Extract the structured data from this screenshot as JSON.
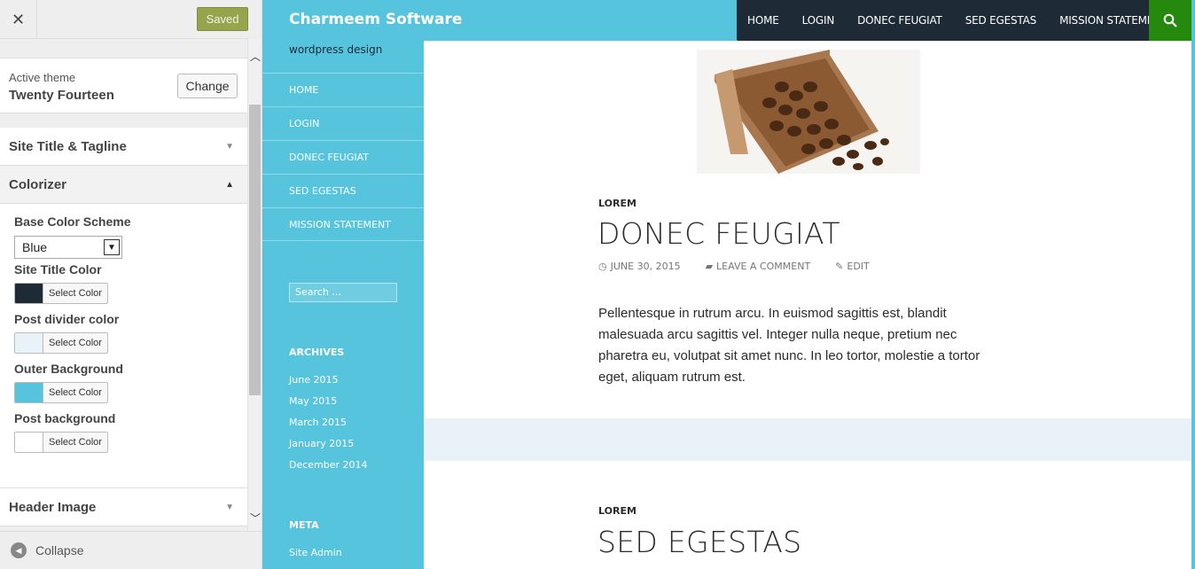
{
  "customizer": {
    "close_icon": "close-icon",
    "saved_label": "Saved",
    "active_theme_label": "Active theme",
    "active_theme_name": "Twenty Fourteen",
    "change_label": "Change",
    "sections": {
      "site_title": "Site Title & Tagline",
      "colorizer": "Colorizer",
      "header_image": "Header Image"
    },
    "colorizer": {
      "base_scheme_label": "Base Color Scheme",
      "base_scheme_value": "Blue",
      "controls": [
        {
          "label": "Site Title Color",
          "button": "Select Color",
          "color": "#1e2b37"
        },
        {
          "label": "Post divider color",
          "button": "Select Color",
          "color": "#e9f1f9"
        },
        {
          "label": "Outer Background",
          "button": "Select Color",
          "color": "#56c4dc"
        },
        {
          "label": "Post background",
          "button": "Select Color",
          "color": "#ffffff"
        }
      ]
    },
    "collapse_label": "Collapse"
  },
  "site": {
    "title": "Charmeem Software",
    "tagline": "wordpress design",
    "top_nav": [
      "HOME",
      "LOGIN",
      "DONEC FEUGIAT",
      "SED EGESTAS",
      "MISSION STATEMENT"
    ],
    "side_nav": [
      "HOME",
      "LOGIN",
      "DONEC FEUGIAT",
      "SED EGESTAS",
      "MISSION STATEMENT"
    ],
    "search_placeholder": "Search …",
    "archives_title": "ARCHIVES",
    "archives": [
      "June 2015",
      "May 2015",
      "March 2015",
      "January 2015",
      "December 2014"
    ],
    "meta_title": "META",
    "meta_links": [
      "Site Admin"
    ]
  },
  "posts": [
    {
      "category": "LOREM",
      "title": "DONEC FEUGIAT",
      "date": "JUNE 30, 2015",
      "comment": "LEAVE A COMMENT",
      "edit": "EDIT",
      "excerpt": "Pellentesque in rutrum arcu. In euismod sagittis est, blandit malesuada arcu sagittis vel. Integer nulla neque, pretium nec pharetra eu, volutpat sit amet nunc. In leo tortor, molestie a tortor eget, aliquam rutrum est."
    },
    {
      "category": "LOREM",
      "title": "SED EGESTAS"
    }
  ],
  "colors": {
    "accent_green": "#24890d",
    "nav_dark": "#1e2b37",
    "outer_blue": "#56c4dc",
    "divider": "#e9f1f9",
    "saved_button": "#8d9d3c"
  }
}
